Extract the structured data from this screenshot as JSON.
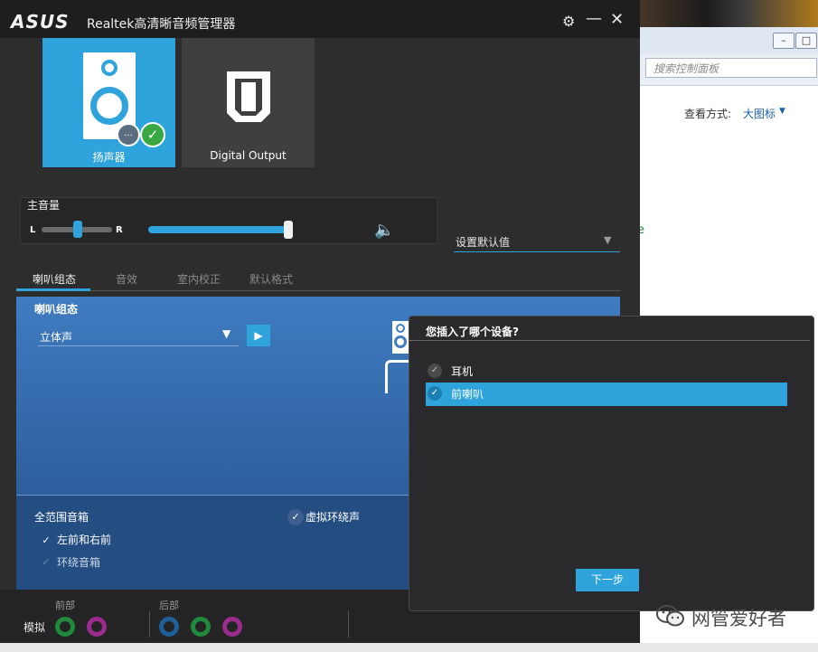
{
  "app": {
    "logo": "ASUS",
    "title": "Realtek高清晰音频管理器",
    "icons": {
      "settings": "gear-icon",
      "minimize": "minimize-icon",
      "close": "close-icon"
    }
  },
  "devices": [
    {
      "label": "扬声器",
      "selected": true
    },
    {
      "label": "Digital Output",
      "selected": false
    }
  ],
  "volume": {
    "title": "主音量",
    "left_label": "L",
    "right_label": "R",
    "balance": 0.5,
    "level": 1.0,
    "default_dropdown": "设置默认值"
  },
  "tabs": [
    "喇叭组态",
    "音效",
    "室内校正",
    "默认格式"
  ],
  "speaker_config": {
    "title": "喇叭组态",
    "mode": "立体声",
    "full_range": "全范围音箱",
    "virtual_surround": "虚拟环绕声",
    "front_lr": "左前和右前",
    "surround": "环绕音箱"
  },
  "jacks": {
    "front": "前部",
    "rear": "后部",
    "analog": "模拟",
    "colors": {
      "green": "#1f8a3c",
      "pink": "#9c2b8e",
      "blue": "#1e5f9a"
    }
  },
  "dialog": {
    "title": "您插入了哪个设备?",
    "options": [
      {
        "label": "耳机",
        "selected": false
      },
      {
        "label": "前喇叭",
        "selected": true
      }
    ],
    "next": "下一步"
  },
  "control_panel": {
    "search_placeholder": "搜索控制面板",
    "view_by": "查看方式:",
    "view_value": "大图标",
    "stray": "e"
  },
  "watermark": "网管爱好者",
  "colors": {
    "accent": "#2ea3dc",
    "panel": "#2d2d2d",
    "content_blue": "#3f7cc0"
  }
}
